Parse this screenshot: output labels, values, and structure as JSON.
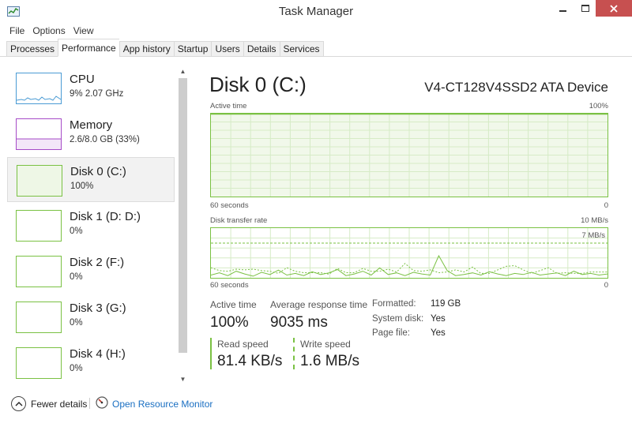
{
  "window": {
    "title": "Task Manager"
  },
  "menu": [
    "File",
    "Options",
    "View"
  ],
  "tabs": [
    "Processes",
    "Performance",
    "App history",
    "Startup",
    "Users",
    "Details",
    "Services"
  ],
  "active_tab": "Performance",
  "sidebar": {
    "items": [
      {
        "title": "CPU",
        "sub": "9%  2.07 GHz",
        "color": "#4a9bd4"
      },
      {
        "title": "Memory",
        "sub": "2.6/8.0 GB (33%)",
        "color": "#a64bc7"
      },
      {
        "title": "Disk 0 (C:)",
        "sub": "100%",
        "color": "#7ac143"
      },
      {
        "title": "Disk 1 (D: D:)",
        "sub": "0%",
        "color": "#7ac143"
      },
      {
        "title": "Disk 2 (F:)",
        "sub": "0%",
        "color": "#7ac143"
      },
      {
        "title": "Disk 3 (G:)",
        "sub": "0%",
        "color": "#7ac143"
      },
      {
        "title": "Disk 4 (H:)",
        "sub": "0%",
        "color": "#7ac143"
      }
    ],
    "selected_index": 2
  },
  "detail": {
    "title": "Disk 0 (C:)",
    "device": "V4-CT128V4SSD2 ATA Device",
    "active_graph": {
      "label": "Active time",
      "max": "100%",
      "x_left": "60 seconds",
      "x_right": "0",
      "value_pct": 100
    },
    "transfer_graph": {
      "label": "Disk transfer rate",
      "max": "10 MB/s",
      "line_label": "7 MB/s",
      "x_left": "60 seconds",
      "x_right": "0"
    },
    "stats": {
      "active_time_label": "Active time",
      "active_time_value": "100%",
      "avg_response_label": "Average response time",
      "avg_response_value": "9035 ms",
      "read_label": "Read speed",
      "read_value": "81.4 KB/s",
      "write_label": "Write speed",
      "write_value": "1.6 MB/s"
    },
    "props": [
      {
        "label": "Formatted:",
        "value": "119 GB"
      },
      {
        "label": "System disk:",
        "value": "Yes"
      },
      {
        "label": "Page file:",
        "value": "Yes"
      }
    ]
  },
  "footer": {
    "fewer_details": "Fewer details",
    "resource_monitor": "Open Resource Monitor"
  },
  "colors": {
    "disk_green": "#7ac143",
    "grid": "#d6ebc6",
    "fill": "#f1f8ea",
    "link": "#1a6fc2",
    "close": "#c75050"
  }
}
